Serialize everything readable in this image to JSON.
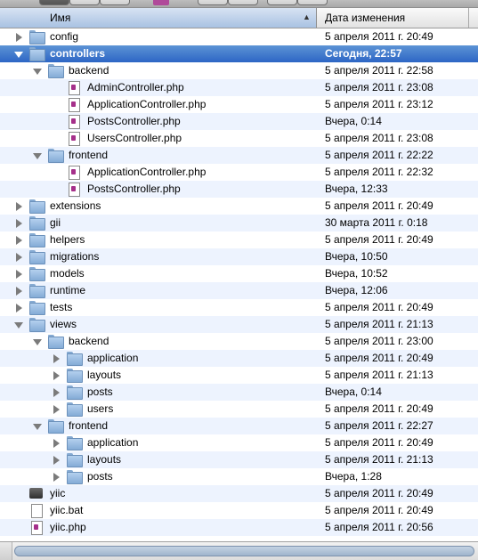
{
  "header": {
    "name_column": "Имя",
    "date_column": "Дата изменения"
  },
  "rows": [
    {
      "name": "config",
      "date": "5 апреля 2011 г. 20:49",
      "icon": "folder-icon",
      "indent": 0,
      "toggle": "collapsed"
    },
    {
      "name": "controllers",
      "date": "Сегодня, 22:57",
      "icon": "folder-icon",
      "indent": 0,
      "toggle": "expanded",
      "selected": true
    },
    {
      "name": "backend",
      "date": "5 апреля 2011 г. 22:58",
      "icon": "folder-icon",
      "indent": 1,
      "toggle": "expanded"
    },
    {
      "name": "AdminController.php",
      "date": "5 апреля 2011 г. 23:08",
      "icon": "php-file-icon",
      "indent": 2,
      "toggle": "none"
    },
    {
      "name": "ApplicationController.php",
      "date": "5 апреля 2011 г. 23:12",
      "icon": "php-file-icon",
      "indent": 2,
      "toggle": "none"
    },
    {
      "name": "PostsController.php",
      "date": "Вчера, 0:14",
      "icon": "php-file-icon",
      "indent": 2,
      "toggle": "none"
    },
    {
      "name": "UsersController.php",
      "date": "5 апреля 2011 г. 23:08",
      "icon": "php-file-icon",
      "indent": 2,
      "toggle": "none"
    },
    {
      "name": "frontend",
      "date": "5 апреля 2011 г. 22:22",
      "icon": "folder-icon",
      "indent": 1,
      "toggle": "expanded"
    },
    {
      "name": "ApplicationController.php",
      "date": "5 апреля 2011 г. 22:32",
      "icon": "php-file-icon",
      "indent": 2,
      "toggle": "none"
    },
    {
      "name": "PostsController.php",
      "date": "Вчера, 12:33",
      "icon": "php-file-icon",
      "indent": 2,
      "toggle": "none"
    },
    {
      "name": "extensions",
      "date": "5 апреля 2011 г. 20:49",
      "icon": "folder-icon",
      "indent": 0,
      "toggle": "collapsed"
    },
    {
      "name": "gii",
      "date": "30 марта 2011 г. 0:18",
      "icon": "folder-icon",
      "indent": 0,
      "toggle": "collapsed"
    },
    {
      "name": "helpers",
      "date": "5 апреля 2011 г. 20:49",
      "icon": "folder-icon",
      "indent": 0,
      "toggle": "collapsed"
    },
    {
      "name": "migrations",
      "date": "Вчера, 10:50",
      "icon": "folder-icon",
      "indent": 0,
      "toggle": "collapsed"
    },
    {
      "name": "models",
      "date": "Вчера, 10:52",
      "icon": "folder-icon",
      "indent": 0,
      "toggle": "collapsed"
    },
    {
      "name": "runtime",
      "date": "Вчера, 12:06",
      "icon": "folder-icon",
      "indent": 0,
      "toggle": "collapsed"
    },
    {
      "name": "tests",
      "date": "5 апреля 2011 г. 20:49",
      "icon": "folder-icon",
      "indent": 0,
      "toggle": "collapsed"
    },
    {
      "name": "views",
      "date": "5 апреля 2011 г. 21:13",
      "icon": "folder-icon",
      "indent": 0,
      "toggle": "expanded"
    },
    {
      "name": "backend",
      "date": "5 апреля 2011 г. 23:00",
      "icon": "folder-icon",
      "indent": 1,
      "toggle": "expanded"
    },
    {
      "name": "application",
      "date": "5 апреля 2011 г. 20:49",
      "icon": "folder-icon",
      "indent": 2,
      "toggle": "collapsed"
    },
    {
      "name": "layouts",
      "date": "5 апреля 2011 г. 21:13",
      "icon": "folder-icon",
      "indent": 2,
      "toggle": "collapsed"
    },
    {
      "name": "posts",
      "date": "Вчера, 0:14",
      "icon": "folder-icon",
      "indent": 2,
      "toggle": "collapsed"
    },
    {
      "name": "users",
      "date": "5 апреля 2011 г. 20:49",
      "icon": "folder-icon",
      "indent": 2,
      "toggle": "collapsed"
    },
    {
      "name": "frontend",
      "date": "5 апреля 2011 г. 22:27",
      "icon": "folder-icon",
      "indent": 1,
      "toggle": "expanded"
    },
    {
      "name": "application",
      "date": "5 апреля 2011 г. 20:49",
      "icon": "folder-icon",
      "indent": 2,
      "toggle": "collapsed"
    },
    {
      "name": "layouts",
      "date": "5 апреля 2011 г. 21:13",
      "icon": "folder-icon",
      "indent": 2,
      "toggle": "collapsed"
    },
    {
      "name": "posts",
      "date": "Вчера, 1:28",
      "icon": "folder-icon",
      "indent": 2,
      "toggle": "collapsed"
    },
    {
      "name": "yiic",
      "date": "5 апреля 2011 г. 20:49",
      "icon": "executable-icon",
      "indent": 0,
      "toggle": "none"
    },
    {
      "name": "yiic.bat",
      "date": "5 апреля 2011 г. 20:49",
      "icon": "text-file-icon",
      "indent": 0,
      "toggle": "none"
    },
    {
      "name": "yiic.php",
      "date": "5 апреля 2011 г. 20:56",
      "icon": "php-file-icon",
      "indent": 0,
      "toggle": "none"
    }
  ]
}
